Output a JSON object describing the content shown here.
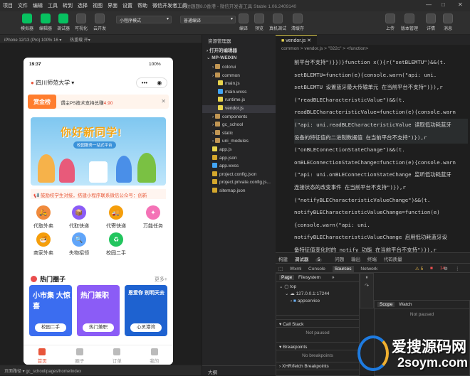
{
  "menubar": {
    "items": [
      "项目",
      "文件",
      "编辑",
      "工具",
      "转到",
      "选择",
      "视图",
      "界面",
      "设置",
      "帮助",
      "微信开发者工具"
    ],
    "window_title": "格仿趣题8.0香港 - 微信开发者工具 Stable 1.06.2409140",
    "controls": [
      "—",
      "□",
      "✕"
    ]
  },
  "toolbar": {
    "left": [
      "模拟器",
      "编辑器",
      "调试器",
      "可视化",
      "云开发"
    ],
    "mode_select": "小程序模式",
    "compile_select": "普通编译",
    "center": [
      "编译",
      "预览",
      "真机调试",
      "清缓存"
    ],
    "right": [
      "上传",
      "版本管理",
      "详情",
      "消息"
    ]
  },
  "simulator": {
    "device": "iPhone 12/13 (Pro) 100% 16 ▾",
    "hotreload": "热重载 开▾",
    "time": "19:37",
    "battery": "100%",
    "location": "四川师范大学",
    "ad": {
      "tag": "赏金榜",
      "text": "谓尘PS技术支持总赚",
      "price": "4.90"
    },
    "banner_title": "你好新同学!",
    "banner_sub": "校园服务一站式平台",
    "notice": "📢 鼓励校学生对接，搭建小程序联系微信公众号：创新",
    "grid": [
      {
        "label": "代取外卖",
        "color": "#f08a3c",
        "icon": "🛵"
      },
      {
        "label": "代取快递",
        "color": "#8b5cf6",
        "icon": "📦"
      },
      {
        "label": "代寄快递",
        "color": "#f59e0b",
        "icon": "🚚"
      },
      {
        "label": "万能任务",
        "color": "#f472b6",
        "icon": "✦"
      },
      {
        "label": "商家外卖",
        "color": "#f59e0b",
        "icon": "🍜"
      },
      {
        "label": "失物招领",
        "color": "#60a5fa",
        "icon": "🔍"
      },
      {
        "label": "校园二手",
        "color": "#22c55e",
        "icon": "♻"
      }
    ],
    "hot_title": "热门圈子",
    "hot_more": "更多+",
    "cards": [
      {
        "head": "小市集 大惊喜",
        "label": "校园二手",
        "color": "#3b6df0"
      },
      {
        "head": "热门兼职",
        "label": "热门兼职",
        "color": "#8b5cf6"
      },
      {
        "head": "恩爱你 别明天去",
        "label": "心灵港湾",
        "color": "#1e62d0"
      }
    ],
    "tabs": [
      "首页",
      "圈子",
      "订单",
      "我的"
    ],
    "path": "页面路径 ▾  gc_school/pages/home/index"
  },
  "explorer": {
    "title": "资源管理器",
    "open_editors": "打开的编辑器",
    "project": "MP-WEIXIN",
    "tree": [
      {
        "name": "colorui",
        "type": "fold",
        "indent": 1
      },
      {
        "name": "common",
        "type": "fold",
        "indent": 1
      },
      {
        "name": "main.js",
        "type": "js",
        "indent": 2
      },
      {
        "name": "main.wxss",
        "type": "wx",
        "indent": 2
      },
      {
        "name": "runtime.js",
        "type": "js",
        "indent": 2
      },
      {
        "name": "vendor.js",
        "type": "js",
        "indent": 2
      },
      {
        "name": "components",
        "type": "fold",
        "indent": 1
      },
      {
        "name": "gc_school",
        "type": "fold",
        "indent": 1
      },
      {
        "name": "static",
        "type": "fold",
        "indent": 1
      },
      {
        "name": "uni_modules",
        "type": "fold",
        "indent": 1
      },
      {
        "name": "app.js",
        "type": "js",
        "indent": 1
      },
      {
        "name": "app.json",
        "type": "json",
        "indent": 1
      },
      {
        "name": "app.wxss",
        "type": "wx",
        "indent": 1
      },
      {
        "name": "project.config.json",
        "type": "json",
        "indent": 1
      },
      {
        "name": "project.private.config.js...",
        "type": "json",
        "indent": 1
      },
      {
        "name": "sitemap.json",
        "type": "json",
        "indent": 1
      }
    ],
    "outline": "大纲"
  },
  "editor": {
    "tab": "vendor.js",
    "breadcrumb": "common > vendor.js > \"022c\" > <function>",
    "lines": [
      "前平台不支持\")}})}function x(){r(\"setBLEMTU\")&&(t.",
      "setBLEMTU=function(e){console.warn(\"api: uni.",
      "setBLEMTU 设置蓝牙最大传输单元 在当前平台不支持\")}),r",
      "(\"readBLECharacteristicValue\")&&(t.",
      "readBLECharacteristicValue=function(e){console.warn",
      "(\"api: uni.readBLECharacteristicValue 读取低功耗蓝牙",
      "设备的特征值的二进制数据值 在当前平台不支持\")}),r",
      "(\"onBLEConnectionStateChange\")&&(t.",
      "onBLEConnectionStateChange=function(e){console.warn",
      "(\"api: uni.onBLEConnectionStateChange 监听低功耗蓝牙",
      "连接状态的改变事件 在当前平台不支持\")}),r",
      "(\"notifyBLECharacteristicValueChange\")&&(t.",
      "notifyBLECharacteristicValueChange=function(e)",
      "{console.warn(\"api: uni.",
      "notifyBLECharacteristicValueChange 启用低功耗蓝牙设",
      "备特征值变化时的 notify 功能 在当前平台不支持\")}),r"
    ]
  },
  "devtools": {
    "top_tabs": [
      "构建",
      "调试器",
      "问题",
      "输出",
      "终端",
      "代码质量"
    ],
    "top_badge": "5",
    "tabs": [
      "Wxml",
      "Console",
      "Sources",
      "Network"
    ],
    "warn": "⚠ 5",
    "err": "14",
    "left_tabs": [
      "Page",
      "Filesystem"
    ],
    "tree": [
      "top",
      "127.0.0.1:17244",
      "appservice"
    ],
    "right_tabs": [
      "Scope",
      "Watch"
    ],
    "not_paused": "Not paused",
    "call_stack": "Call Stack",
    "breakpoints": "Breakpoints",
    "no_breakpoints": "No breakpoints",
    "xhr": "XHR/fetch Breakpoints"
  },
  "watermark": {
    "title": "爱搜源码网",
    "sub": "2soym.com"
  }
}
